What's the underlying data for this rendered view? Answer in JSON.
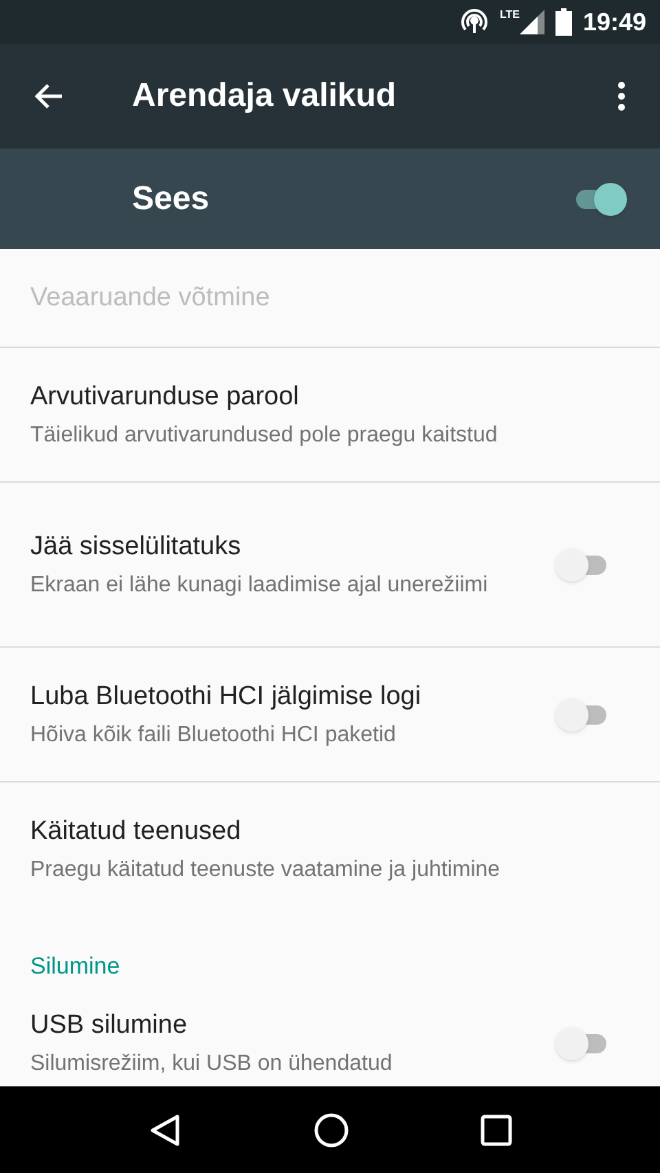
{
  "status_bar": {
    "time": "19:49",
    "network": "LTE"
  },
  "toolbar": {
    "title": "Arendaja valikud"
  },
  "master_switch": {
    "label": "Sees",
    "on": true
  },
  "items": [
    {
      "kind": "item",
      "title": "Veaaruande võtmine",
      "disabled": true
    },
    {
      "kind": "item",
      "title": "Arvutivarunduse parool",
      "subtitle": "Täielikud arvutivarundused pole praegu kaitstud",
      "disabled": false
    },
    {
      "kind": "switch",
      "title": "Jää sisselülitatuks",
      "subtitle": "Ekraan ei lähe kunagi laadimise ajal unerežiimi",
      "on": false,
      "disabled": false
    },
    {
      "kind": "switch",
      "title": "Luba Bluetoothi HCI jälgimise logi",
      "subtitle": "Hõiva kõik faili Bluetoothi HCI paketid",
      "on": false,
      "disabled": false
    },
    {
      "kind": "item",
      "title": "Käitatud teenused",
      "subtitle": "Praegu käitatud teenuste vaatamine ja juhtimine",
      "disabled": false
    },
    {
      "kind": "header",
      "title": "Silumine"
    },
    {
      "kind": "switch",
      "title": "USB silumine",
      "subtitle": "Silumisrežiim, kui USB on ühendatud",
      "on": false,
      "disabled": false
    }
  ]
}
